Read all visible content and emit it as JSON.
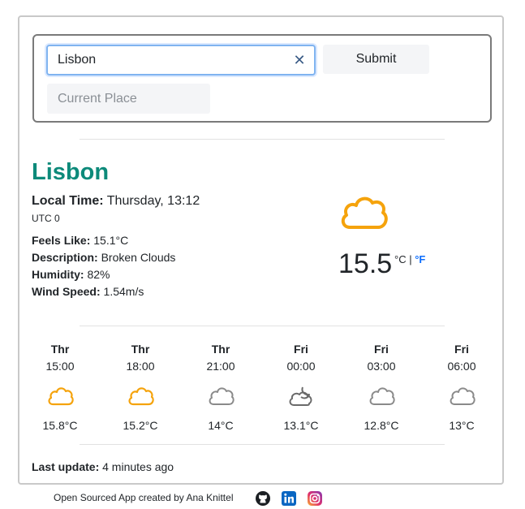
{
  "search": {
    "value": "Lisbon",
    "submit_label": "Submit",
    "current_place_label": "Current Place"
  },
  "current": {
    "city": "Lisbon",
    "local_time_label": "Local Time:",
    "local_time_value": "Thursday, 13:12",
    "utc": "UTC 0",
    "feels_like_label": "Feels Like:",
    "feels_like_value": "15.1°C",
    "description_label": "Description:",
    "description_value": "Broken Clouds",
    "humidity_label": "Humidity:",
    "humidity_value": "82%",
    "wind_label": "Wind Speed:",
    "wind_value": "1.54m/s",
    "temperature": "15.5",
    "unit_c": "°C",
    "unit_sep": "|",
    "unit_f": "°F",
    "icon": "cloud-icon"
  },
  "forecast": [
    {
      "day": "Thr",
      "time": "15:00",
      "temp": "15.8°C",
      "icon": "cloud-icon",
      "color": "#f5a30c"
    },
    {
      "day": "Thr",
      "time": "18:00",
      "temp": "15.2°C",
      "icon": "cloud-icon",
      "color": "#f5a30c"
    },
    {
      "day": "Thr",
      "time": "21:00",
      "temp": "14°C",
      "icon": "cloud-icon",
      "color": "#8a8a8a"
    },
    {
      "day": "Fri",
      "time": "00:00",
      "temp": "13.1°C",
      "icon": "moon-cloud-icon",
      "color": "#6a6a6a"
    },
    {
      "day": "Fri",
      "time": "03:00",
      "temp": "12.8°C",
      "icon": "cloud-icon",
      "color": "#8a8a8a"
    },
    {
      "day": "Fri",
      "time": "06:00",
      "temp": "13°C",
      "icon": "cloud-icon",
      "color": "#8a8a8a"
    }
  ],
  "last_update": {
    "label": "Last update:",
    "value": "4 minutes ago"
  },
  "footer": {
    "text": "Open Sourced App created by Ana Knittel"
  },
  "colors": {
    "accent": "#0d8a7a",
    "link": "#0d6efd",
    "sun_cloud": "#f5a30c",
    "gray_cloud": "#8a8a8a"
  }
}
